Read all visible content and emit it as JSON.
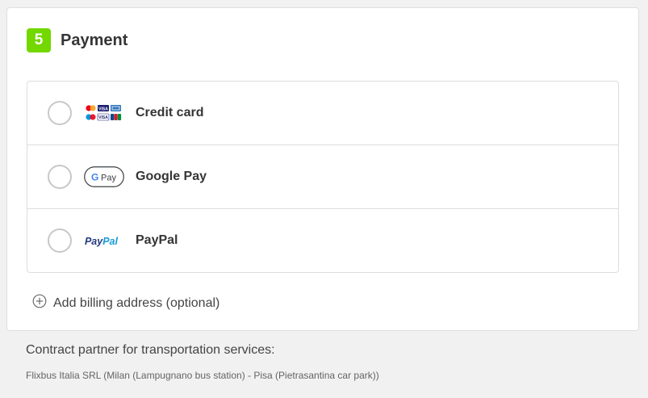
{
  "colors": {
    "accent": "#73d700",
    "title": "#353535",
    "text": "#444444",
    "muted": "#646464",
    "paypal_dark": "#253b80",
    "paypal_light": "#179bd7"
  },
  "payment": {
    "step_number": "5",
    "title": "Payment",
    "options": [
      {
        "label": "Credit card",
        "icon": "credit-cards-icon",
        "selected": false
      },
      {
        "label": "Google Pay",
        "icon": "google-pay-icon",
        "logo_text": "Pay",
        "selected": false
      },
      {
        "label": "PayPal",
        "icon": "paypal-icon",
        "logo_text_a": "Pay",
        "logo_text_b": "Pal",
        "selected": false
      }
    ],
    "billing": {
      "label": "Add billing address (optional)",
      "icon": "plus-circle-icon"
    }
  },
  "contract": {
    "title": "Contract partner for transportation services:",
    "detail": "Flixbus Italia SRL (Milan (Lampugnano bus station) - Pisa (Pietrasantina car park))"
  }
}
